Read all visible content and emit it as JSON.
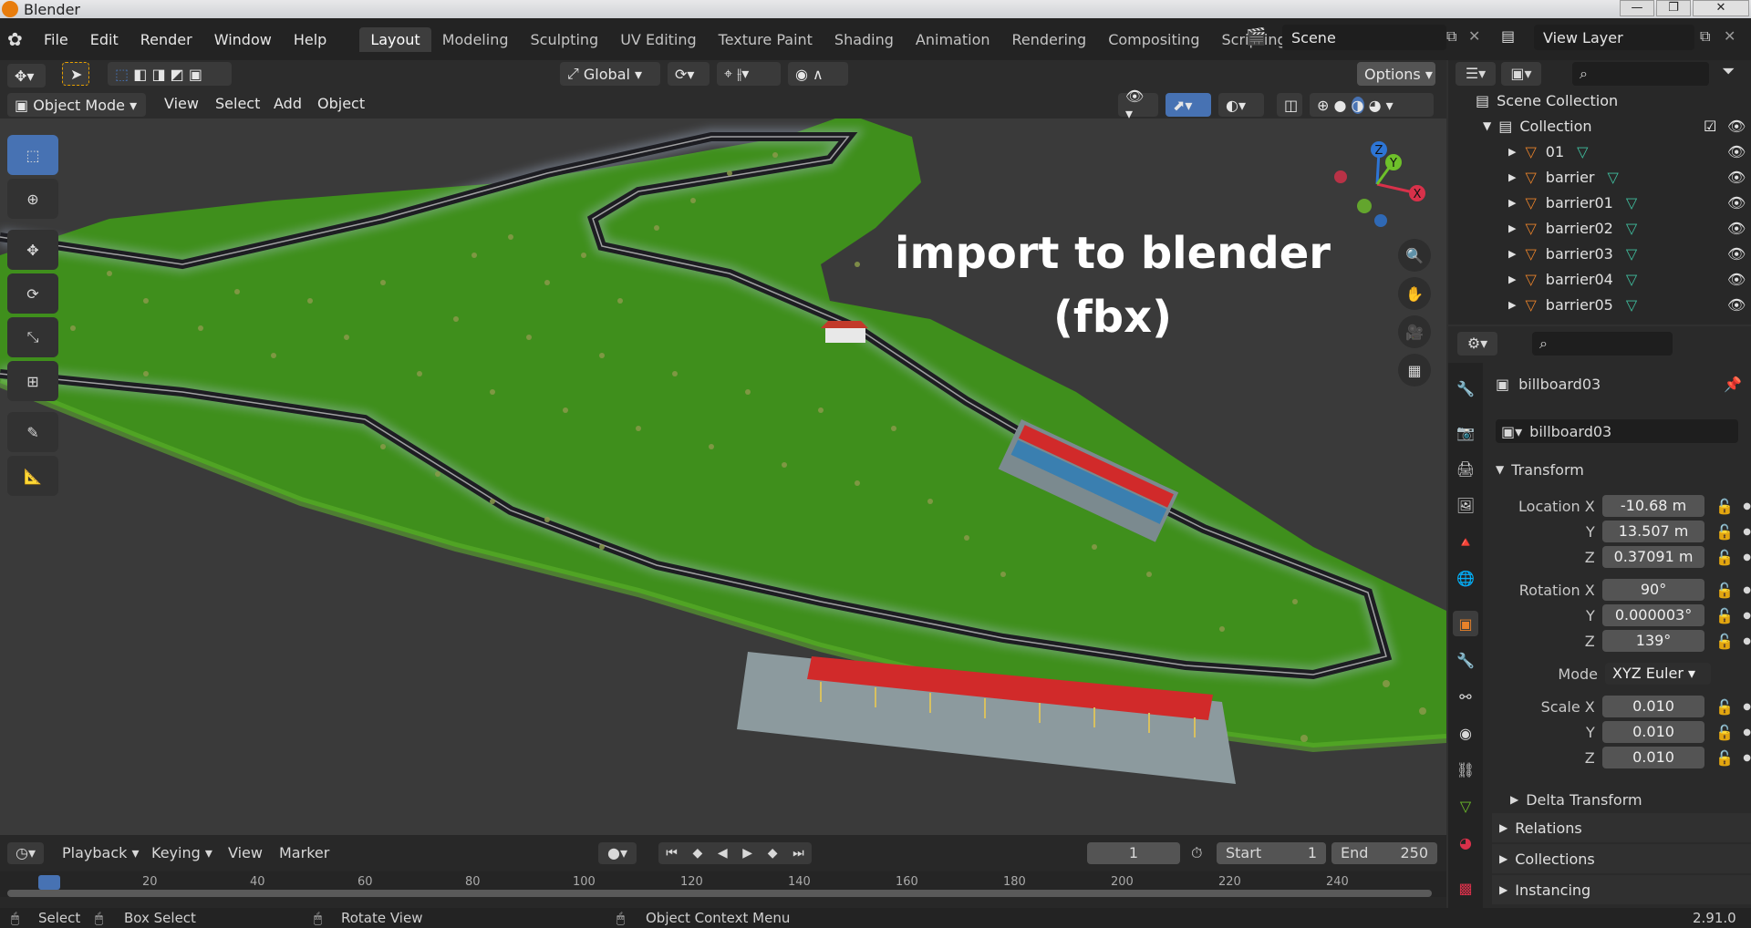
{
  "window": {
    "title": "Blender"
  },
  "menus": [
    "File",
    "Edit",
    "Render",
    "Window",
    "Help"
  ],
  "workspaces": [
    {
      "label": "Layout",
      "active": true
    },
    {
      "label": "Modeling"
    },
    {
      "label": "Sculpting"
    },
    {
      "label": "UV Editing"
    },
    {
      "label": "Texture Paint"
    },
    {
      "label": "Shading"
    },
    {
      "label": "Animation"
    },
    {
      "label": "Rendering"
    },
    {
      "label": "Compositing"
    },
    {
      "label": "Scripting"
    }
  ],
  "add_workspace": "+",
  "scene": {
    "name": "Scene",
    "view_layer": "View Layer"
  },
  "tool_header": {
    "orientation": "Global",
    "options": "Options"
  },
  "viewport_header": {
    "mode": "Object Mode",
    "menus": [
      "View",
      "Select",
      "Add",
      "Object"
    ]
  },
  "overlay_text": {
    "line1": "import to blender",
    "line2": "(fbx)"
  },
  "gizmo": {
    "x": "X",
    "y": "Y",
    "z": "Z"
  },
  "outliner": {
    "root": "Scene Collection",
    "collection": "Collection",
    "items": [
      "01",
      "barrier",
      "barrier01",
      "barrier02",
      "barrier03",
      "barrier04",
      "barrier05"
    ]
  },
  "properties": {
    "object_name": "billboard03",
    "data_name": "billboard03",
    "transform_title": "Transform",
    "location": {
      "label": "Location X",
      "x": "-10.68 m",
      "y": "13.507 m",
      "z": "0.37091 m"
    },
    "rotation": {
      "label": "Rotation X",
      "x": "90°",
      "y": "0.000003°",
      "z": "139°"
    },
    "mode": {
      "label": "Mode",
      "value": "XYZ Euler"
    },
    "scale": {
      "label": "Scale X",
      "x": "0.010",
      "y": "0.010",
      "z": "0.010"
    },
    "axis_y": "Y",
    "axis_z": "Z",
    "delta": "Delta Transform",
    "sections": [
      "Relations",
      "Collections",
      "Instancing"
    ]
  },
  "timeline": {
    "menus": [
      "Playback",
      "Keying",
      "View",
      "Marker"
    ],
    "current_frame": "1",
    "start_label": "Start",
    "start": "1",
    "end_label": "End",
    "end": "250",
    "ruler": [
      "1",
      "20",
      "40",
      "60",
      "80",
      "100",
      "120",
      "140",
      "160",
      "180",
      "200",
      "220",
      "240"
    ]
  },
  "statusbar": {
    "select": "Select",
    "box_select": "Box Select",
    "rotate": "Rotate View",
    "context": "Object Context Menu",
    "version": "2.91.0"
  },
  "colors": {
    "accent": "#4772b3",
    "grass": "#3f8f1c",
    "track": "#1d1d22",
    "seats_red": "#d12a2a",
    "seats_blue": "#3a7fb0"
  }
}
